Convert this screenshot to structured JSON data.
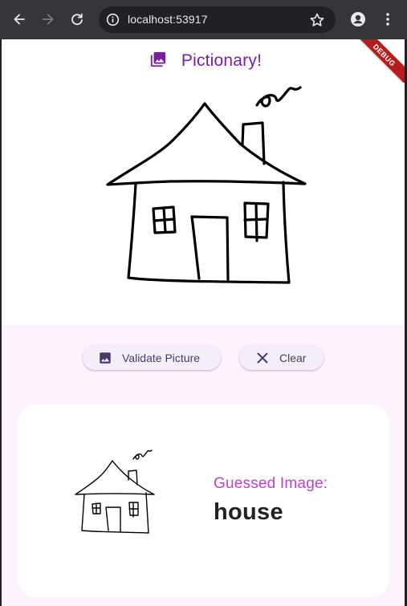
{
  "browser": {
    "url": "localhost:53917",
    "back_icon": "arrow-left",
    "forward_icon": "arrow-right",
    "reload_icon": "reload",
    "info_icon": "info",
    "star_icon": "star",
    "profile_icon": "person",
    "menu_icon": "kebab"
  },
  "app": {
    "title": "Pictionary!",
    "title_icon": "photo-library",
    "debug_banner": "DEBUG",
    "accent_color": "#7b1fa2"
  },
  "actions": {
    "validate_label": "Validate Picture",
    "validate_icon": "image",
    "clear_label": "Clear",
    "clear_icon": "close"
  },
  "result": {
    "label": "Guessed Image:",
    "value": "house",
    "label_color": "#c03fd0"
  }
}
